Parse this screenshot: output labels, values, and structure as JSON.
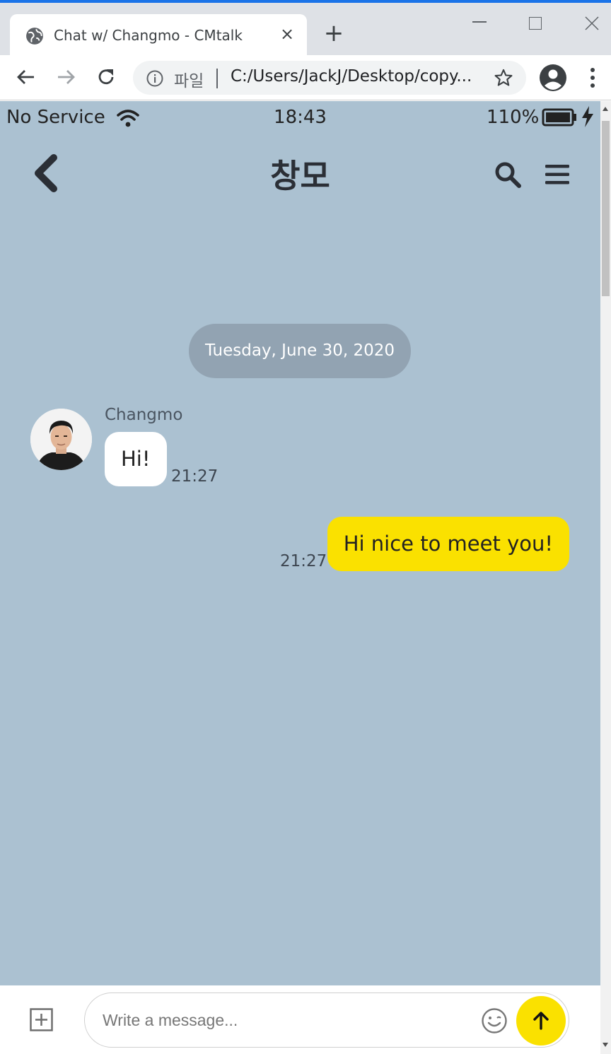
{
  "browser": {
    "tab_title": "Chat w/ Changmo - CMtalk",
    "tab_close": "×",
    "new_tab": "+",
    "address_scheme": "파일",
    "address_url": "C:/Users/JackJ/Desktop/copy..."
  },
  "status_bar": {
    "carrier": "No Service",
    "time": "18:43",
    "battery_percent": "110%"
  },
  "header": {
    "title": "창모"
  },
  "chat": {
    "date_divider": "Tuesday, June 30, 2020",
    "messages": [
      {
        "direction": "incoming",
        "sender": "Changmo",
        "text": "Hi!",
        "time": "21:27"
      },
      {
        "direction": "outgoing",
        "text": "Hi nice to meet you!",
        "time": "21:27"
      }
    ]
  },
  "composer": {
    "placeholder": "Write a message..."
  },
  "colors": {
    "chat_background": "#abc1d1",
    "outgoing_bubble": "#fae100",
    "incoming_bubble": "#ffffff",
    "date_pill": "#92a3b2",
    "send_button": "#fae100"
  },
  "icons": [
    "globe-icon",
    "close-icon",
    "plus-icon",
    "back-arrow-icon",
    "forward-arrow-icon",
    "reload-icon",
    "info-icon",
    "star-icon",
    "profile-icon",
    "kebab-menu-icon",
    "wifi-icon",
    "battery-icon",
    "charging-bolt-icon",
    "chevron-left-icon",
    "search-icon",
    "hamburger-menu-icon",
    "add-attachment-icon",
    "emoji-icon",
    "send-arrow-icon"
  ]
}
